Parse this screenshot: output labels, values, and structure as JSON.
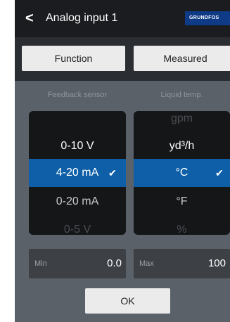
{
  "header": {
    "back_icon": "chevron-left-icon",
    "back_glyph": "<",
    "title": "Analog input 1",
    "logo_text": "GRUNDFOS"
  },
  "tabs": [
    {
      "label": "Function"
    },
    {
      "label": "Measured"
    }
  ],
  "columns": {
    "left_label": "Feedback sensor",
    "right_label": "Liquid temp."
  },
  "feedback_sensor": {
    "items": [
      "0-10 V",
      "4-20 mA",
      "0-20 mA",
      "0-5 V"
    ],
    "selected": "4-20 mA"
  },
  "liquid_temp": {
    "items": [
      "gpm",
      "yd³/h",
      "°C",
      "°F",
      "%"
    ],
    "selected": "°C"
  },
  "check_glyph": "✔",
  "range": {
    "min_label": "Min",
    "min_value": "0.0",
    "max_label": "Max",
    "max_value": "100"
  },
  "ok_label": "OK",
  "colors": {
    "selected": "#0f5fa8",
    "header": "#1a1c1f",
    "background": "#5b6168",
    "logo": "#0e3a86"
  }
}
